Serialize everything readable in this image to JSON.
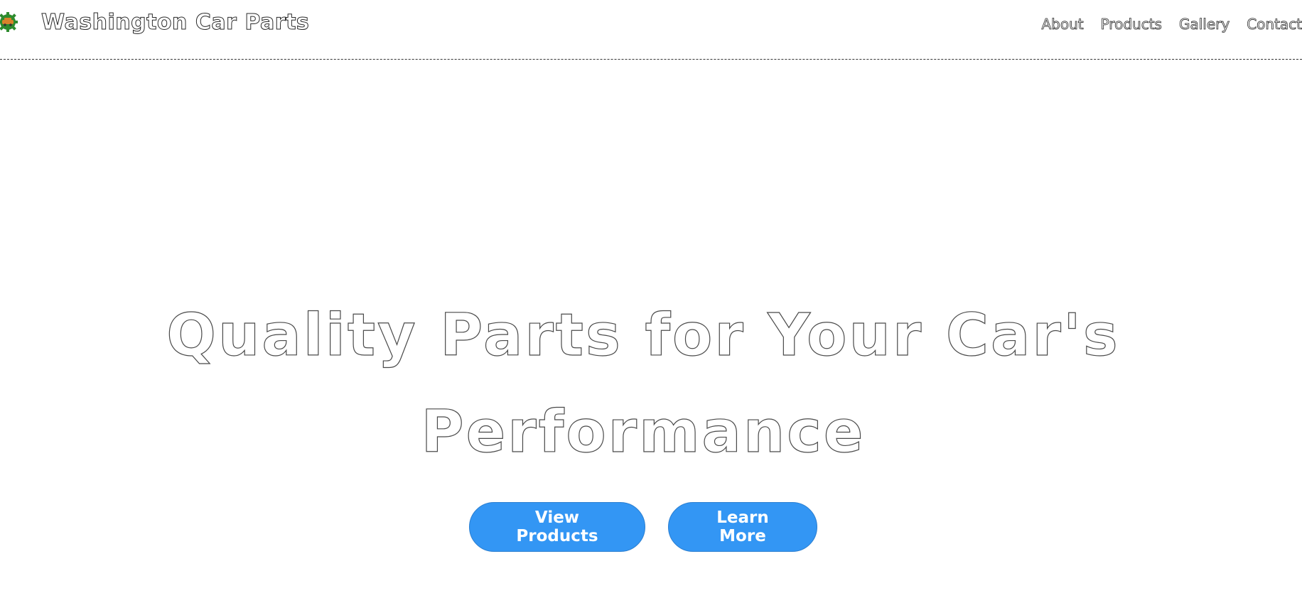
{
  "header": {
    "brand": "Washington Car Parts",
    "logo_icon": "gear-car-logo-icon",
    "nav": [
      {
        "label": "About"
      },
      {
        "label": "Products"
      },
      {
        "label": "Gallery"
      },
      {
        "label": "Contact"
      }
    ]
  },
  "hero": {
    "title_line1": "Quality Parts for Your Car's",
    "title_line2": "Performance",
    "buttons": {
      "primary": "View Products",
      "secondary": "Learn More"
    }
  },
  "colors": {
    "accent": "#3396f4",
    "logo_green": "#2e8b2e",
    "logo_orange": "#d9822b"
  }
}
